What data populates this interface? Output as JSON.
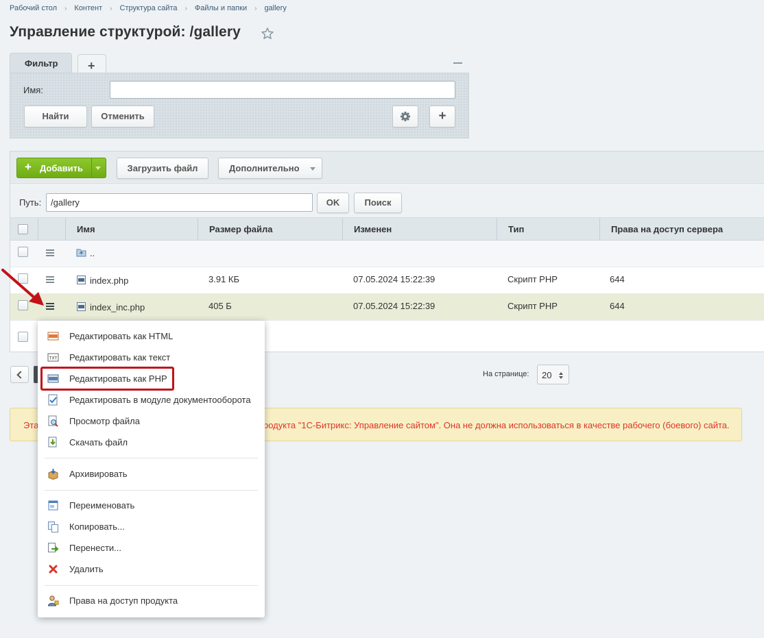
{
  "breadcrumbs": [
    "Рабочий стол",
    "Контент",
    "Структура сайта",
    "Файлы и папки",
    "gallery"
  ],
  "page_title": "Управление структурой: /gallery",
  "filter": {
    "tab_label": "Фильтр",
    "name_label": "Имя:",
    "name_value": "",
    "find_label": "Найти",
    "cancel_label": "Отменить"
  },
  "toolbar": {
    "add_label": "Добавить",
    "upload_label": "Загрузить файл",
    "more_label": "Дополнительно"
  },
  "path": {
    "label": "Путь:",
    "value": "/gallery",
    "ok_label": "OK",
    "search_label": "Поиск"
  },
  "grid": {
    "columns": [
      "Имя",
      "Размер файла",
      "Изменен",
      "Тип",
      "Права на доступ сервера"
    ],
    "rows": [
      {
        "name": "..",
        "size": "",
        "modified": "",
        "type": "",
        "rights": ""
      },
      {
        "name": "index.php",
        "size": "3.91 КБ",
        "modified": "07.05.2024 15:22:39",
        "type": "Скрипт PHP",
        "rights": "644"
      },
      {
        "name": "index_inc.php",
        "size": "405 Б",
        "modified": "07.05.2024 15:22:39",
        "type": "Скрипт PHP",
        "rights": "644"
      }
    ]
  },
  "pagination": {
    "per_page_label": "На странице:",
    "per_page_value": "20"
  },
  "warning": {
    "text_left": "Эта",
    "text_right": "родукта \"1С-Битрикс: Управление сайтом\". Она не должна использоваться в качестве рабочего (боевого) сайта."
  },
  "context_menu": {
    "items": [
      {
        "label": "Редактировать как HTML",
        "icon": "edit-html-icon"
      },
      {
        "label": "Редактировать как текст",
        "icon": "edit-text-icon"
      },
      {
        "label": "Редактировать как PHP",
        "icon": "edit-php-icon"
      },
      {
        "label": "Редактировать в модуле документооборота",
        "icon": "workflow-icon"
      },
      {
        "label": "Просмотр файла",
        "icon": "view-file-icon"
      },
      {
        "label": "Скачать файл",
        "icon": "download-icon"
      },
      {
        "label": "Архивировать",
        "icon": "archive-icon"
      },
      {
        "label": "Переименовать",
        "icon": "rename-icon"
      },
      {
        "label": "Копировать...",
        "icon": "copy-icon"
      },
      {
        "label": "Перенести...",
        "icon": "move-icon"
      },
      {
        "label": "Удалить",
        "icon": "delete-icon"
      },
      {
        "label": "Права на доступ продукта",
        "icon": "access-rights-icon"
      }
    ]
  },
  "colors": {
    "accent_green": "#7ab61e",
    "highlight_red": "#c1121a",
    "warning_text": "#e0332b"
  }
}
